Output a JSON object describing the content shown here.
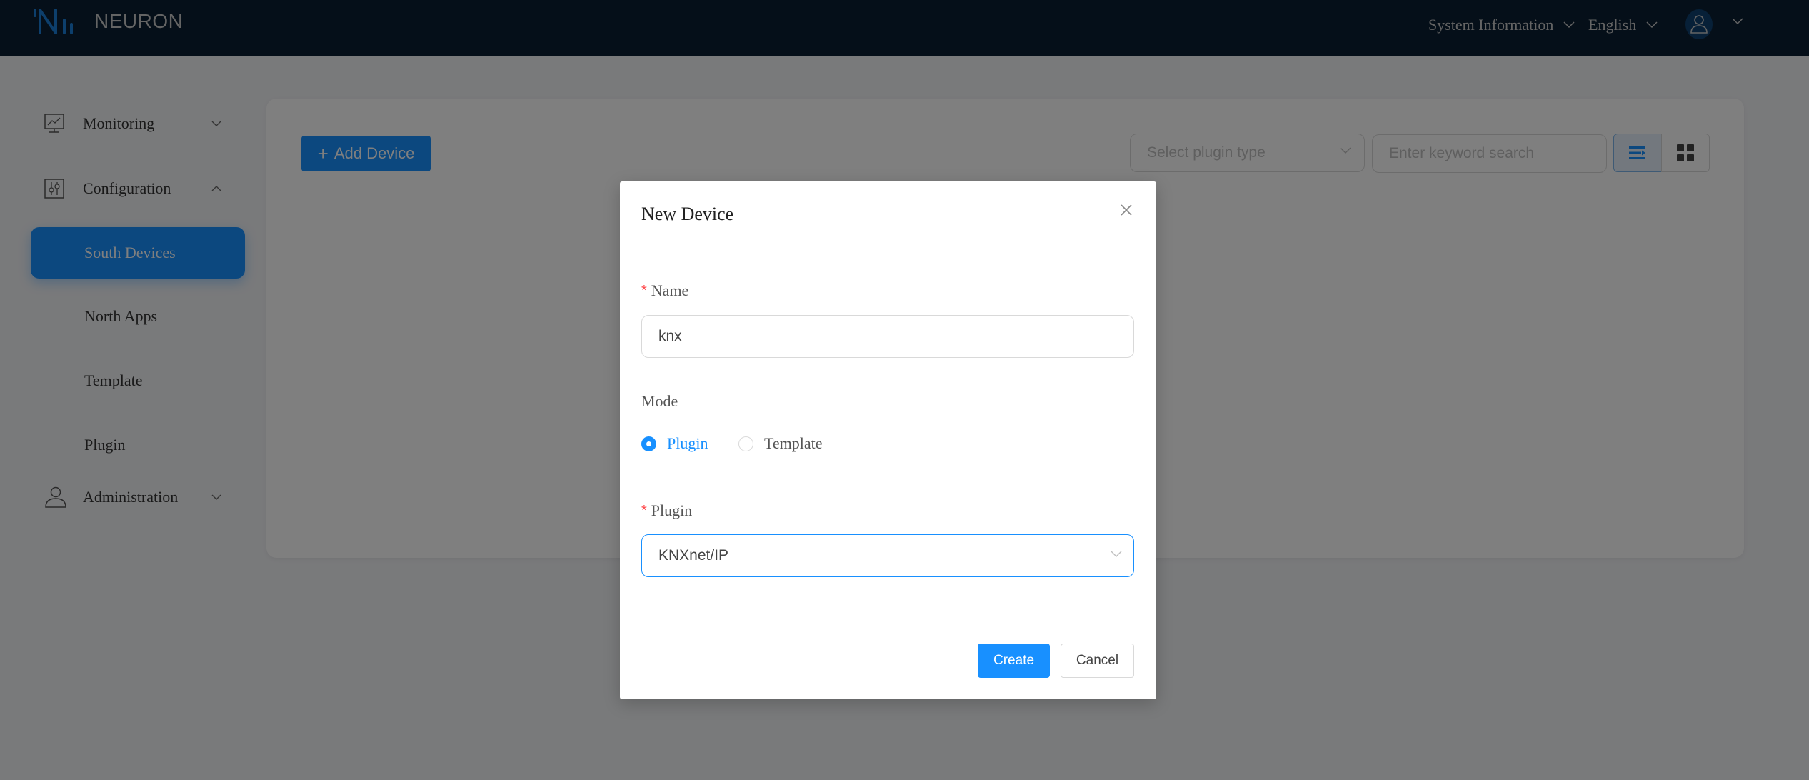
{
  "header": {
    "brand": "NEURON",
    "system_info": "System Information",
    "language": "English",
    "user_icon": "user-icon"
  },
  "sidebar": {
    "monitoring": {
      "label": "Monitoring",
      "icon": "monitor-chart-icon",
      "expanded": false
    },
    "configuration": {
      "label": "Configuration",
      "icon": "sliders-icon",
      "expanded": true,
      "children": [
        {
          "label": "South Devices",
          "active": true
        },
        {
          "label": "North Apps",
          "active": false
        },
        {
          "label": "Template",
          "active": false
        },
        {
          "label": "Plugin",
          "active": false
        }
      ]
    },
    "administration": {
      "label": "Administration",
      "icon": "user-icon",
      "expanded": false
    }
  },
  "main": {
    "add_button": "Add Device",
    "plugin_type_placeholder": "Select plugin type",
    "keyword_placeholder": "Enter keyword search",
    "view_mode": "list"
  },
  "modal": {
    "title": "New Device",
    "name_label": "Name",
    "name_value": "knx",
    "mode_label": "Mode",
    "mode_options": [
      {
        "label": "Plugin",
        "checked": true
      },
      {
        "label": "Template",
        "checked": false
      }
    ],
    "plugin_label": "Plugin",
    "plugin_value": "KNXnet/IP",
    "create_label": "Create",
    "cancel_label": "Cancel"
  },
  "colors": {
    "primary": "#1890ff",
    "header_bg": "#0a1e32",
    "required": "#ff4d4f"
  }
}
